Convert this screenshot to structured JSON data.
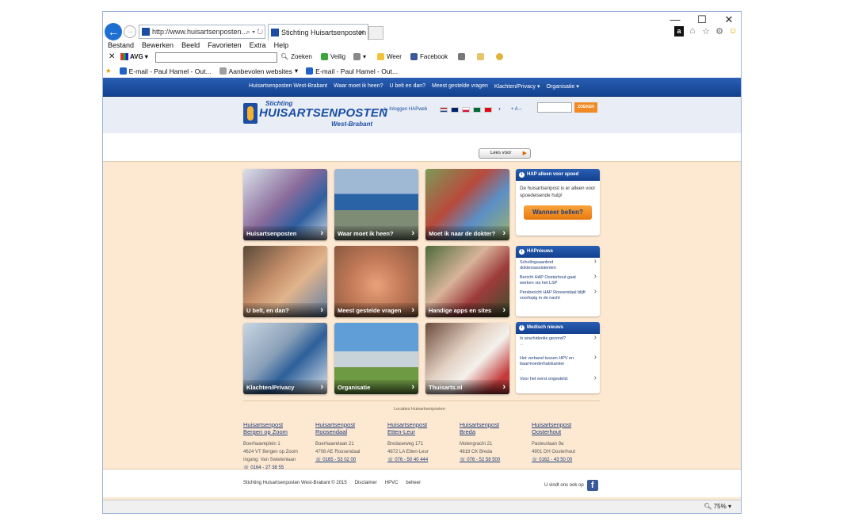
{
  "browser": {
    "address": "http://www.huisartsenposten...",
    "tab_title": "Stichting Huisartsenposten ...",
    "menu": [
      "Bestand",
      "Bewerken",
      "Beeld",
      "Favorieten",
      "Extra",
      "Help"
    ],
    "toolbar": {
      "avg": "AVG",
      "zoeken": "Zoeken",
      "veilig": "Veilig",
      "weer": "Weer",
      "facebook": "Facebook"
    },
    "favorites": [
      "E-mail - Paul Hamel - Out...",
      "Aanbevolen websites",
      "E-mail - Paul Hamel - Out..."
    ],
    "zoom": "75%"
  },
  "site": {
    "nav": [
      "Huisartsenposten West-Brabant",
      "Waar moet ik heen?",
      "U belt en dan?",
      "Meest gestelde vragen",
      "Klachten/Privacy ▾",
      "Organisatie ▾"
    ],
    "logo": {
      "line1": "Stichting",
      "line2": "HUISARTSENPOSTEN",
      "line3": "West-Brabant"
    },
    "login": "Inloggen HAPweb",
    "font_size": "+ A –",
    "search_button": "ZOEKEN",
    "lees_voor": "Lees voor",
    "tiles": [
      {
        "label": "Huisartsenposten"
      },
      {
        "label": "Waar moet ik heen?"
      },
      {
        "label": "Moet ik naar de dokter?"
      },
      {
        "label": "U belt, en dan?"
      },
      {
        "label": "Meest gestelde vragen"
      },
      {
        "label": "Handige apps en sites"
      },
      {
        "label": "Klachten/Privacy"
      },
      {
        "label": "Organisatie"
      },
      {
        "label": "Thuisarts.nl"
      }
    ],
    "spoed": {
      "title": "HAP alleen voor spoed",
      "text": "De huisartsenpost is er alleen voor spoedeisende hulp!",
      "button": "Wanneer bellen?"
    },
    "hapnieuws": {
      "title": "HAPnieuws",
      "items": [
        "Scholingsaanbod doktersassistenten",
        "Bericht HAP Oosterhout gaat werken via het LSP",
        "Persbericht HAP Roosendaal blijft voorlopig in de nacht"
      ]
    },
    "medisch": {
      "title": "Medisch nieuws",
      "items": [
        {
          "title": "Is arachideolie gezond?",
          "sub": "..."
        },
        {
          "title": "Het verband tussen HPV en baarmoederhalskanker",
          "sub": "..."
        },
        {
          "title": "Voor het eerst ongesteld:",
          "sub": ""
        }
      ]
    },
    "locations_title": "Locaties Huisartsenposten",
    "locations": [
      {
        "name1": "Huisartsenpost",
        "name2": "Bergen op Zoom",
        "addr1": "Boerhaaveplein 1",
        "addr2": "4624 VT Bergen op Zoom",
        "addr3": "Ingang: Van Swietenlaan",
        "tel": "0164 - 27 38 55"
      },
      {
        "name1": "Huisartsenpost",
        "name2": "Roosendaal",
        "addr1": "Boerhaavelaan 21",
        "addr2": "4708 AE Roosendaal",
        "addr3": "",
        "tel": "0165 - 53 02 00"
      },
      {
        "name1": "Huisartsenpost",
        "name2": "Etten-Leur",
        "addr1": "Bredaseweg 171",
        "addr2": "4872 LA Etten-Leur",
        "addr3": "",
        "tel": "076 - 50 40 444"
      },
      {
        "name1": "Huisartsenpost",
        "name2": "Breda",
        "addr1": "Molengracht 21",
        "addr2": "4818 CK Breda",
        "addr3": "",
        "tel": "076 - 52 58 500"
      },
      {
        "name1": "Huisartsenpost",
        "name2": "Oosterhout",
        "addr1": "Pasteurlaan 9a",
        "addr2": "4901 DH Oosterhout",
        "addr3": "",
        "tel": "0162 - 43 50 00"
      }
    ],
    "footer": {
      "copyright": "Stichting Huisartsenposten West-Brabant © 2015",
      "links": [
        "Disclaimer",
        "HPVC",
        "beheer"
      ],
      "social": "U vindt ons ook op"
    }
  }
}
